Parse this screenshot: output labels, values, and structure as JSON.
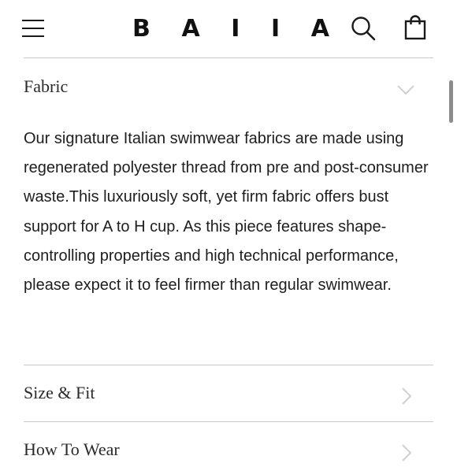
{
  "header": {
    "logo_letters": [
      "B",
      "A",
      "I",
      "I",
      "A"
    ],
    "icons": {
      "menu": "hamburger-menu-icon",
      "search": "search-icon",
      "bag": "shopping-bag-icon"
    }
  },
  "accordion": {
    "fabric": {
      "title": "Fabric",
      "state": "expanded",
      "description": "Our signature Italian swimwear fabrics are made using regenerated polyester thread from pre and post-consumer waste.This luxuriously soft, yet firm fabric offers bust support for A to H cup. As this piece features shape-controlling properties and high technical performance, please expect it to feel firmer than regular swimwear."
    },
    "size_fit": {
      "title": "Size & Fit",
      "state": "collapsed"
    },
    "how_to_wear": {
      "title": "How To Wear",
      "state": "collapsed"
    }
  },
  "colors": {
    "text": "#1a1a1a",
    "divider": "#c9c9c9",
    "chevron": "#d0d0d0"
  }
}
